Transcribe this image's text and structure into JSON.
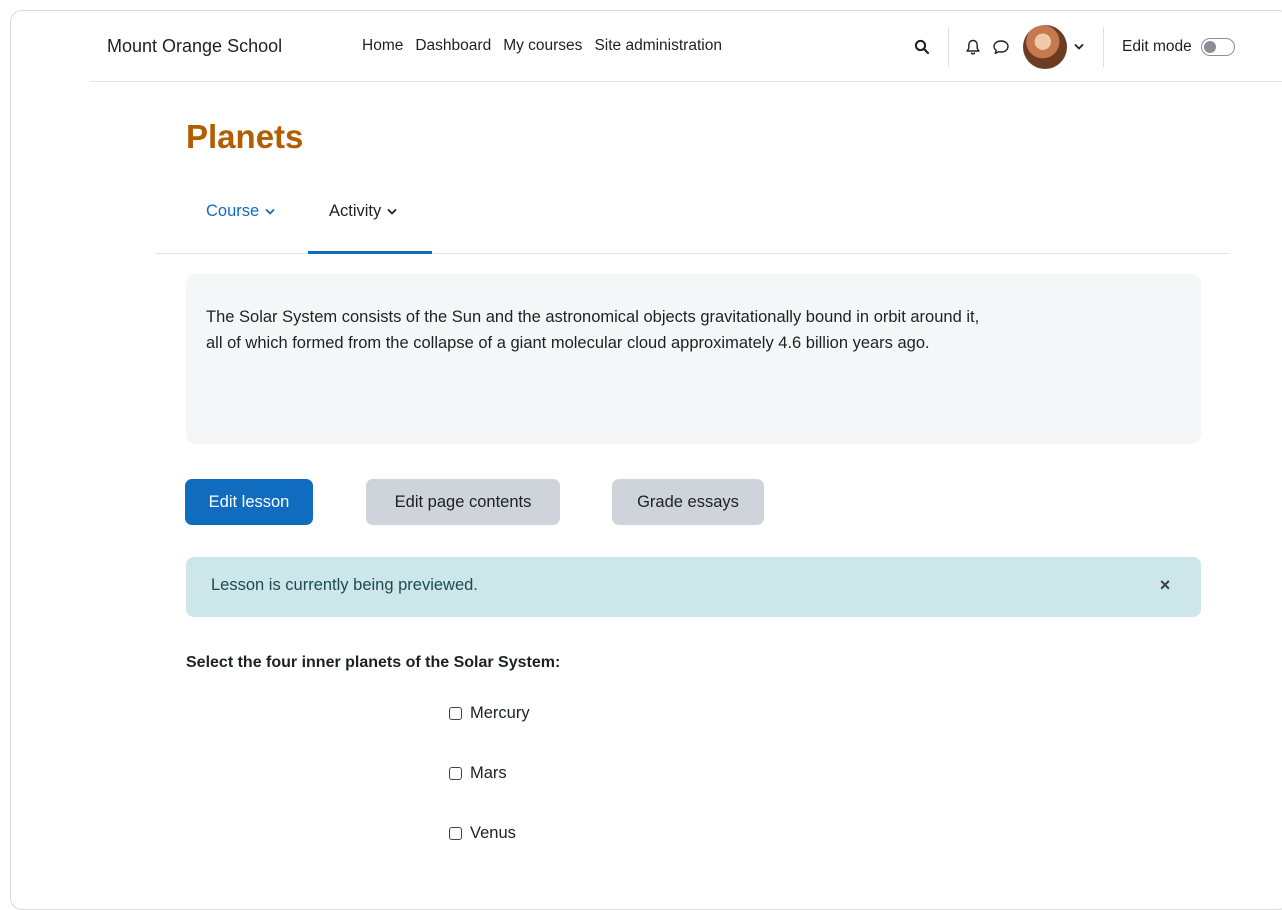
{
  "navbar": {
    "brand": "Mount Orange School",
    "links": [
      "Home",
      "Dashboard",
      "My courses",
      "Site administration"
    ],
    "edit_mode_label": "Edit mode",
    "icons": [
      "search-icon",
      "bell-icon",
      "chat-icon",
      "chevron-down-icon"
    ]
  },
  "page": {
    "title": "Planets"
  },
  "secondary_nav": {
    "tabs": [
      {
        "label": "Course",
        "active": false
      },
      {
        "label": "Activity",
        "active": true
      }
    ]
  },
  "intro": {
    "text_line1": "The Solar System consists of the Sun and the astronomical objects gravitationally bound in orbit around it,",
    "text_line2": "all of which formed from the collapse of a giant molecular cloud approximately 4.6 billion years ago."
  },
  "actions": {
    "edit_lesson": "Edit lesson",
    "edit_page_contents": "Edit page contents",
    "grade_essays": "Grade essays"
  },
  "alert": {
    "message": "Lesson is currently being previewed.",
    "close_symbol": "×"
  },
  "question": {
    "prompt": "Select the four inner planets of the Solar System:",
    "options": [
      {
        "label": "Mercury",
        "checked": false
      },
      {
        "label": "Mars",
        "checked": false
      },
      {
        "label": "Venus",
        "checked": false
      }
    ]
  },
  "colors": {
    "title": "#b35c00",
    "primary": "#0f6cbf",
    "secondary_button": "#ced4da",
    "alert_bg": "#cce6ea",
    "intro_bg": "#f5f6f7"
  }
}
